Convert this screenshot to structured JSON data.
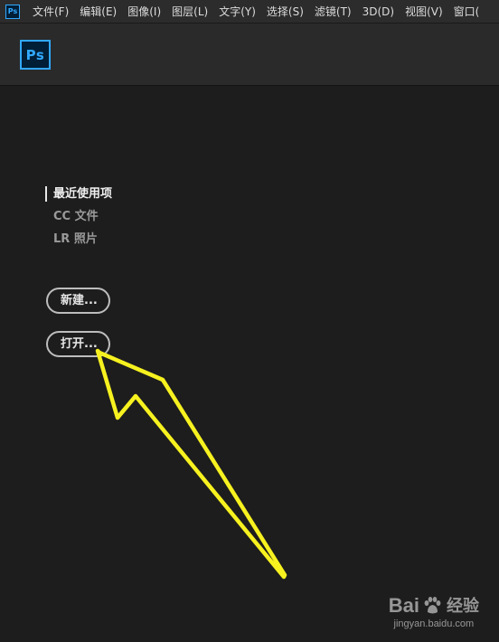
{
  "menubar": {
    "app_icon": "Ps",
    "items": [
      {
        "label": "文件(F)"
      },
      {
        "label": "编辑(E)"
      },
      {
        "label": "图像(I)"
      },
      {
        "label": "图层(L)"
      },
      {
        "label": "文字(Y)"
      },
      {
        "label": "选择(S)"
      },
      {
        "label": "滤镜(T)"
      },
      {
        "label": "3D(D)"
      },
      {
        "label": "视图(V)"
      },
      {
        "label": "窗口("
      }
    ]
  },
  "header": {
    "logo": "Ps"
  },
  "nav": {
    "items": [
      {
        "label": "最近使用项",
        "active": true
      },
      {
        "label": "CC 文件",
        "active": false
      },
      {
        "label": "LR 照片",
        "active": false
      }
    ]
  },
  "actions": {
    "new_label": "新建...",
    "open_label": "打开..."
  },
  "annotation": {
    "arrow_color": "#f7f21f",
    "icon": "arrow-pointer"
  },
  "watermark": {
    "brand_left": "Bai",
    "brand_right": "经验",
    "subtitle": "jingyan.baidu.com",
    "icon": "baidu-paw-icon"
  },
  "colors": {
    "background": "#1d1d1d",
    "menubar": "#2c2c2c",
    "header": "#2a2a2a",
    "ps_blue": "#31a8ff",
    "ps_dark": "#001e36"
  }
}
